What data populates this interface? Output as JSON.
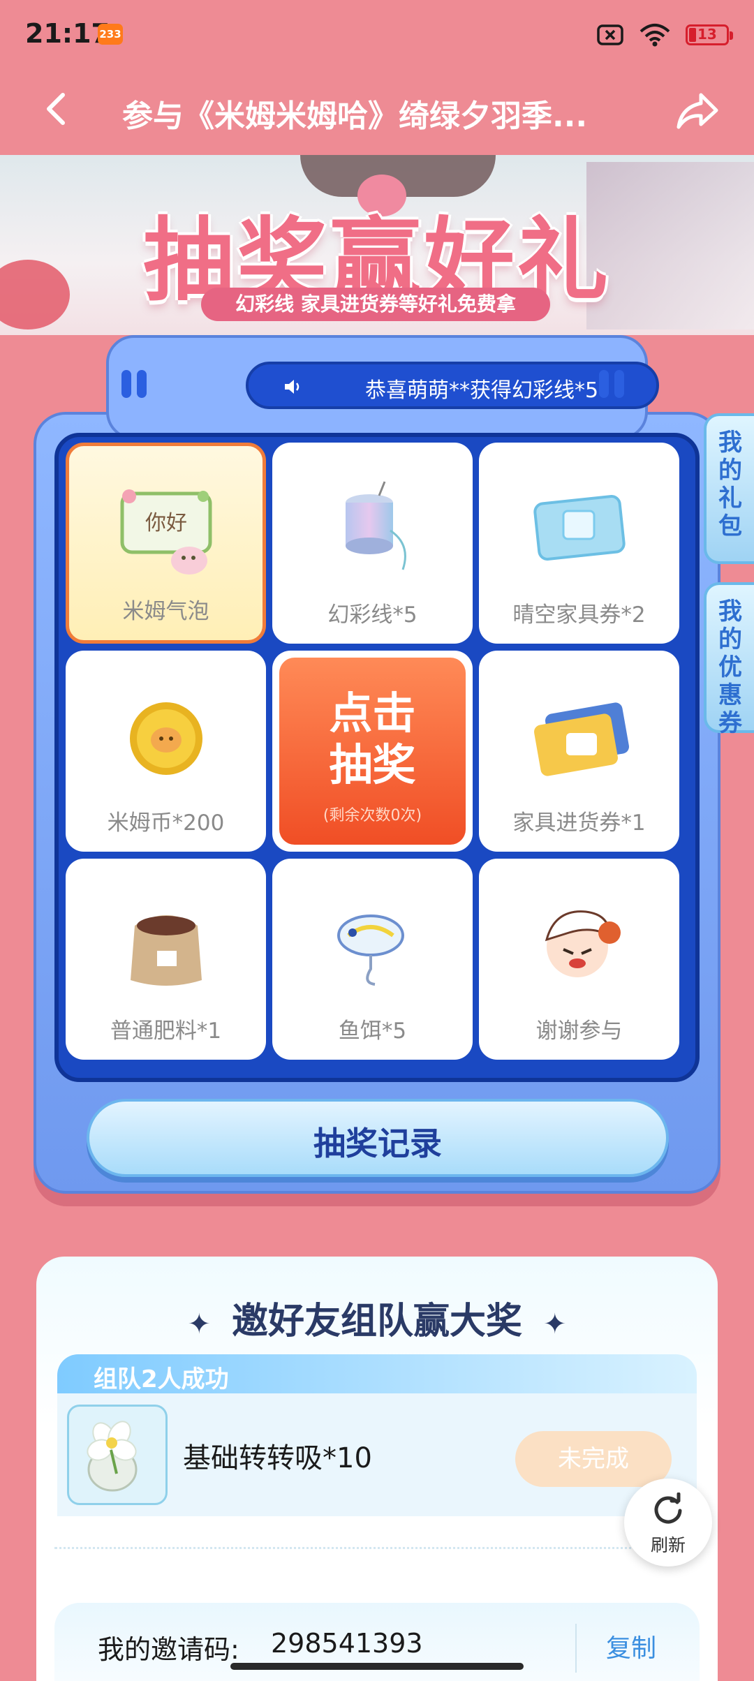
{
  "status_bar": {
    "time": "21:17",
    "app_badge": "233",
    "battery": "13"
  },
  "navbar": {
    "title": "参与《米姆米姆哈》绮绿夕羽季..."
  },
  "banner": {
    "title": "抽奖赢好礼",
    "subtitle": "幻彩线 家具进货券等好礼免费拿"
  },
  "lottery": {
    "ticker": "恭喜萌萌**获得幻彩线*5",
    "prizes": [
      {
        "label": "米姆气泡",
        "icon": "mim-bubble-icon",
        "selected": true
      },
      {
        "label": "幻彩线*5",
        "icon": "yarn-spool-icon"
      },
      {
        "label": "晴空家具券*2",
        "icon": "ice-ticket-icon"
      },
      {
        "label": "米姆币*200",
        "icon": "gold-coin-icon"
      },
      {
        "label": "家具进货券*1",
        "icon": "furniture-ticket-icon"
      },
      {
        "label": "普通肥料*1",
        "icon": "fertilizer-bag-icon"
      },
      {
        "label": "鱼饵*5",
        "icon": "fish-lure-icon"
      },
      {
        "label": "谢谢参与",
        "icon": "cartoon-face-icon"
      }
    ],
    "bubble_text": "你好",
    "draw_button": {
      "line1": "点击",
      "line2": "抽奖",
      "remaining": "(剩余次数0次)"
    },
    "record_button": "抽奖记录"
  },
  "side_tabs": {
    "gift": "我的礼包",
    "coupon": "我的优惠券"
  },
  "team": {
    "title": "邀好友组队赢大奖",
    "header": "组队2人成功",
    "task_name": "基础转转吸*10",
    "task_status": "未完成",
    "refresh": "刷新",
    "invite_label": "我的邀请码:",
    "invite_code": "298541393",
    "copy": "复制"
  },
  "colors": {
    "page_bg": "#ee8b94",
    "grid_bg": "#1a49c2",
    "draw_orange": "#f04e25",
    "accent_blue": "#3b8fe0"
  }
}
